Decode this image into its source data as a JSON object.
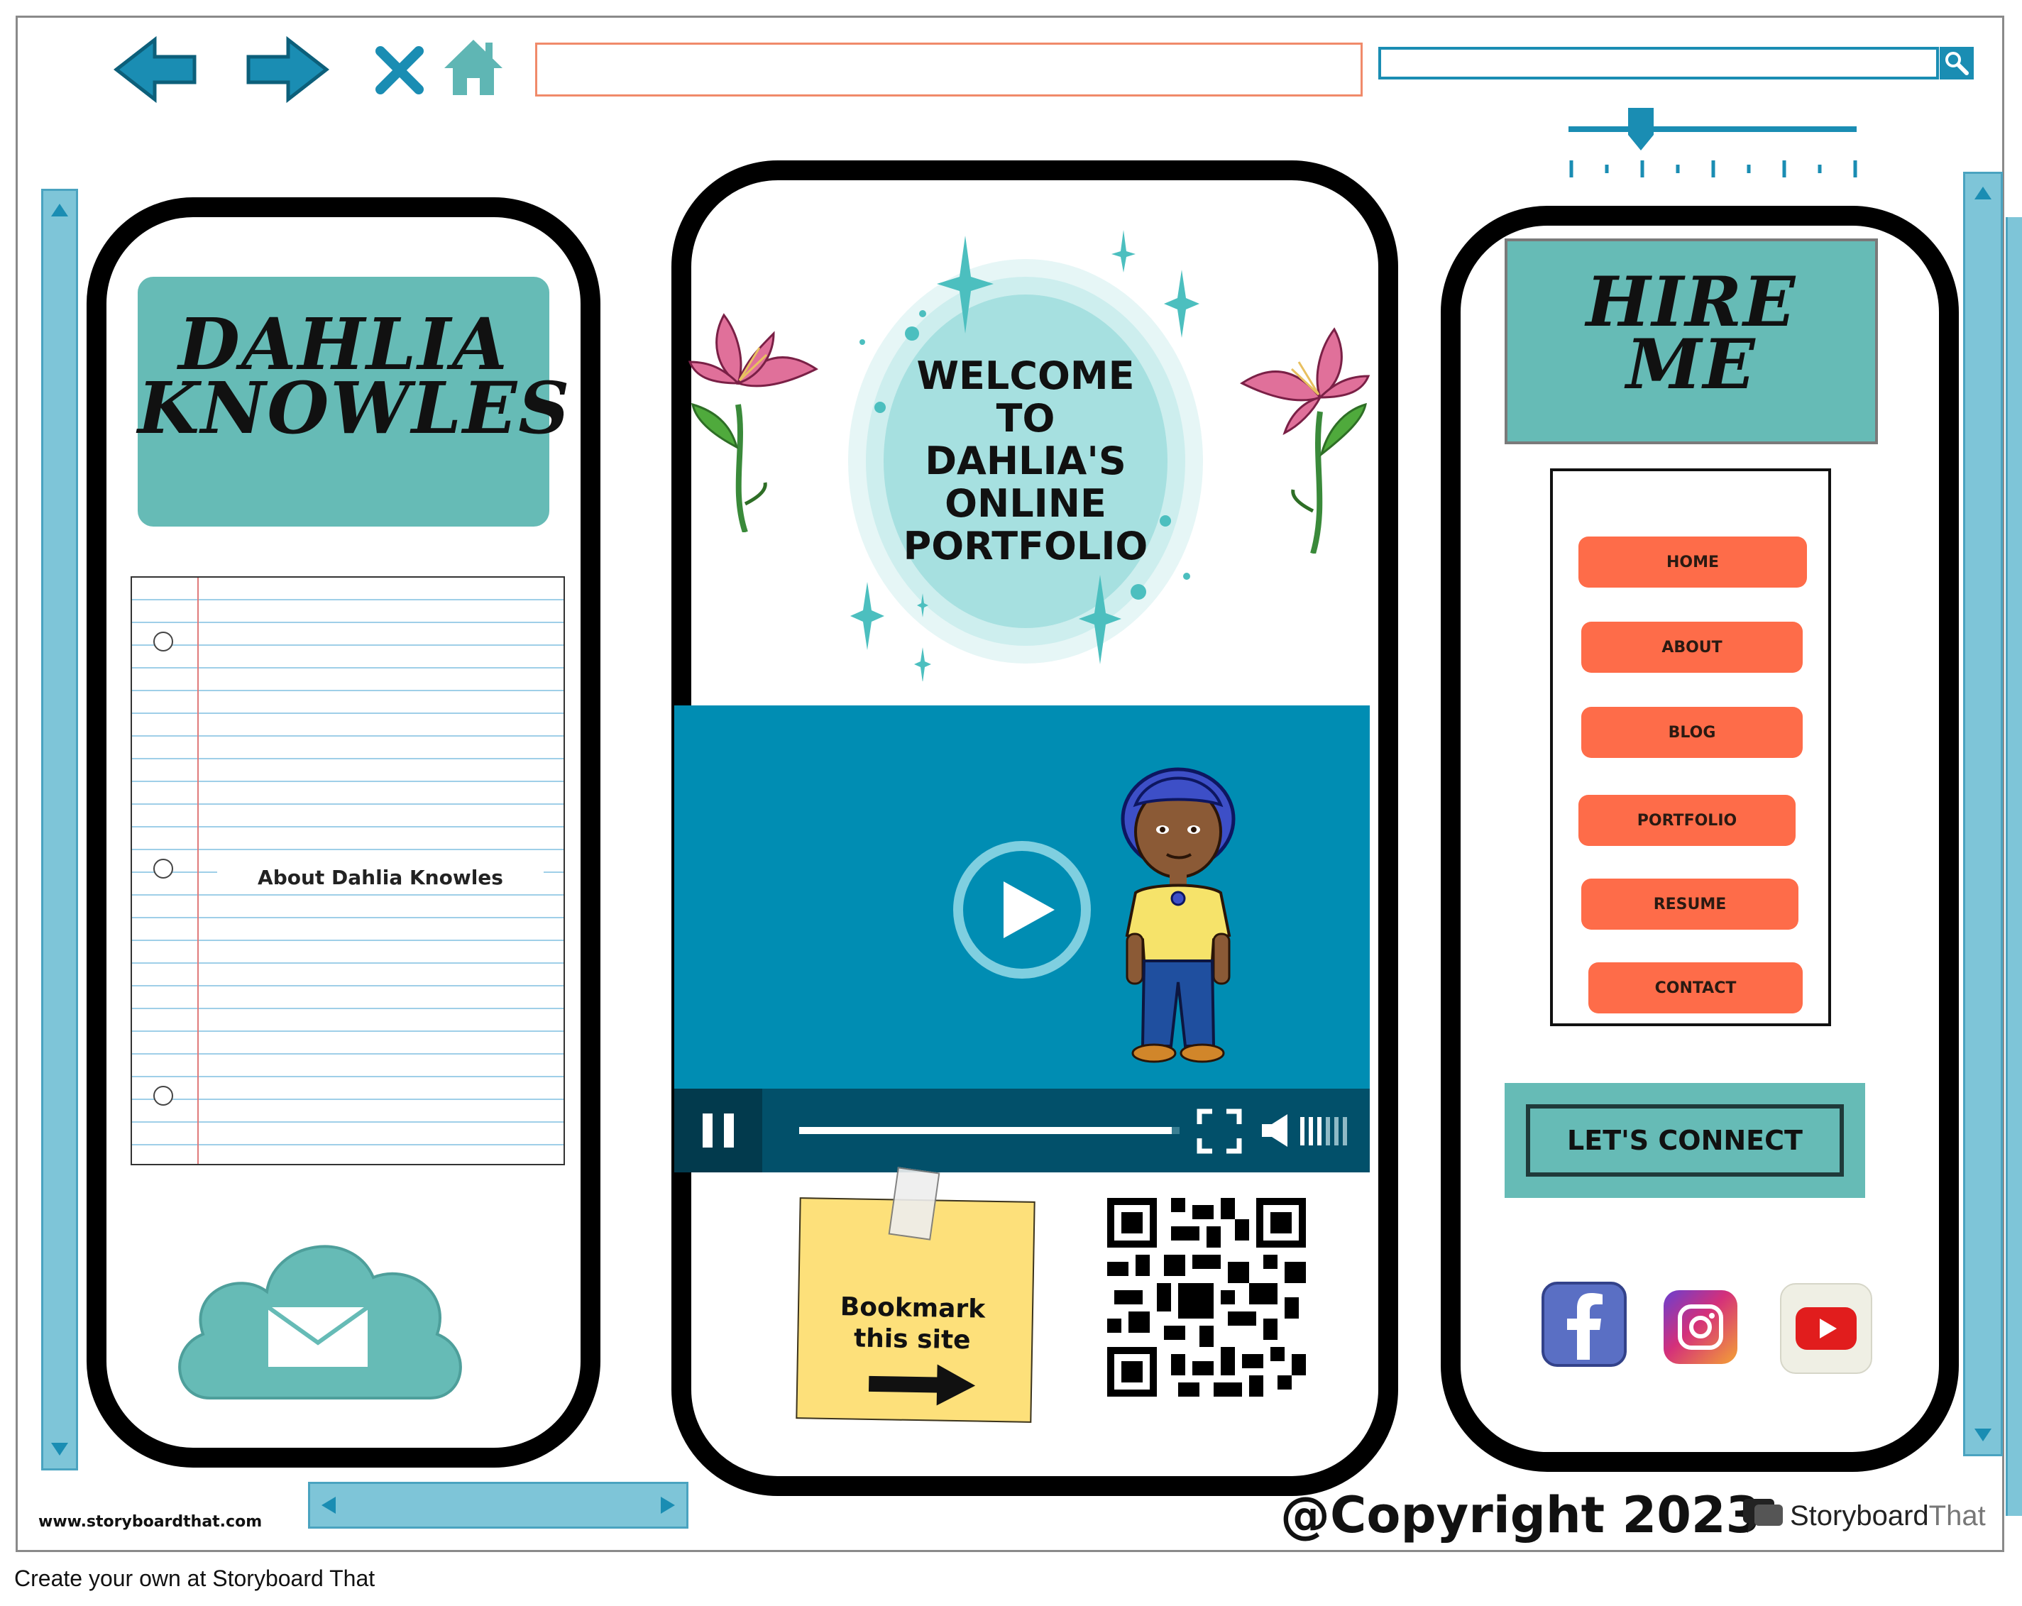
{
  "browser": {
    "address_value": "",
    "search_value": "",
    "zoom_level": 0.25
  },
  "left_panel": {
    "name_line1": "DAHLIA",
    "name_line2": "KNOWLES",
    "about_text": "About Dahlia Knowles"
  },
  "center_panel": {
    "welcome_lines": [
      "WELCOME",
      "TO",
      "DAHLIA'S",
      "ONLINE",
      "PORTFOLIO"
    ],
    "video_progress": 0.98,
    "sticky_note_text": "Bookmark this site"
  },
  "right_panel": {
    "hire_line1": "HIRE",
    "hire_line2": "ME",
    "nav_items": [
      {
        "label": "HOME"
      },
      {
        "label": "ABOUT"
      },
      {
        "label": "BLOG"
      },
      {
        "label": "PORTFOLIO"
      },
      {
        "label": "RESUME"
      },
      {
        "label": "CONTACT"
      }
    ],
    "connect_label": "LET'S CONNECT",
    "social": [
      "facebook-icon",
      "instagram-icon",
      "youtube-icon"
    ]
  },
  "footer": {
    "website": "www.storyboardthat.com",
    "copyright": "@Copyright 2023",
    "brand_story": "Storyboard",
    "brand_that": "That",
    "caption": "Create your own at Storyboard That"
  },
  "colors": {
    "teal": "#66bbb6",
    "blue": "#1a8db3",
    "orange": "#fe6c49",
    "video_bg": "#008db3"
  }
}
